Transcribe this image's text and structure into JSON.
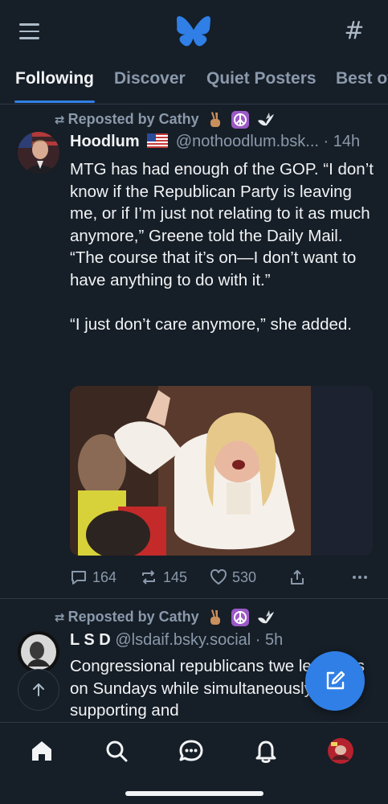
{
  "header": {
    "menu_icon": "hamburger-menu-icon",
    "logo_icon": "bluesky-butterfly-icon",
    "feeds_icon": "hashtag-icon",
    "feeds_glyph": "#",
    "brand_color": "#2f7fe6"
  },
  "tabs": [
    {
      "label": "Following",
      "active": true
    },
    {
      "label": "Discover",
      "active": false
    },
    {
      "label": "Quiet Posters",
      "active": false
    },
    {
      "label": "Best of",
      "active": false
    }
  ],
  "posts": [
    {
      "repost_label": "Reposted by Cathy",
      "repost_emojis": [
        "victory-hand-icon",
        "peace-symbol-icon",
        "dove-icon"
      ],
      "author": "Hoodlum",
      "flag": "us-flag-icon",
      "handle": "@nothoodlum.bsk...",
      "time": "· 14h",
      "text": "MTG has had enough of the GOP. “I don’t know if the Republican Party is leaving me, or if I’m just not relating to it as much anymore,” Greene told the Daily Mail. “The course that it’s on—I don’t want to have anything to do with it.”\n\n“I just don’t care anymore,” she added.",
      "has_image": true,
      "replies": "164",
      "reposts": "145",
      "likes": "530"
    },
    {
      "repost_label": "Reposted by Cathy",
      "repost_emojis": [
        "victory-hand-icon",
        "peace-symbol-icon",
        "dove-icon"
      ],
      "author": "L S D",
      "handle": "@lsdaif.bsky.social",
      "time": "· 5h",
      "text": "Congressional republicans twe          le verses on Sundays while simultaneously supporting and"
    }
  ],
  "bottom_nav": [
    "home-icon",
    "search-icon",
    "chat-icon",
    "notifications-bell-icon",
    "profile-avatar"
  ]
}
